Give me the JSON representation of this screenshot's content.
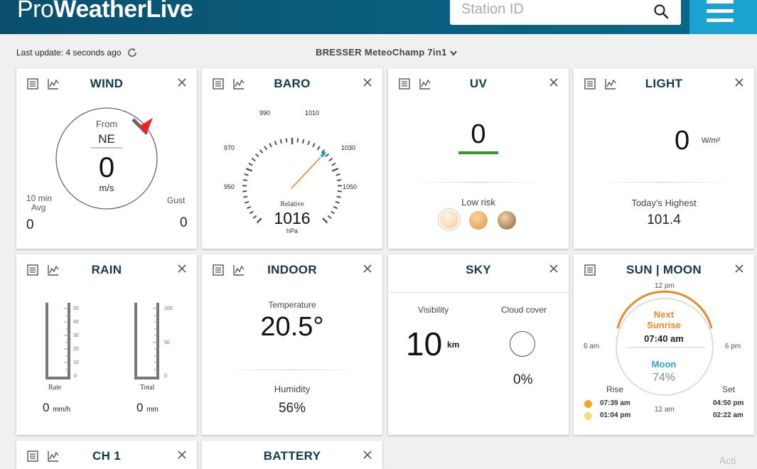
{
  "header": {
    "logo_pro": "Pro",
    "logo_weatherlive": "WeatherLive",
    "search_placeholder": "Station ID"
  },
  "subbar": {
    "last_update": "Last update: 4 seconds ago",
    "station": "BRESSER MeteoChamp 7in1"
  },
  "colors": {
    "header": "#0a5a7a",
    "menu": "#1aa3d1",
    "uv_bar": "#2e9b2e",
    "sun_arc": "#e8892b",
    "moon_text": "#2aa7c9"
  },
  "cards": {
    "wind": {
      "title": "WIND",
      "from_label": "From",
      "direction": "NE",
      "speed": "0",
      "unit": "m/s",
      "avg_label_1": "10 min",
      "avg_label_2": "Avg",
      "avg_value": "0",
      "gust_label": "Gust",
      "gust_value": "0"
    },
    "baro": {
      "title": "BARO",
      "ticks": [
        "950",
        "970",
        "990",
        "1010",
        "1030",
        "1050"
      ],
      "relative_label": "Relative",
      "value": "1016",
      "unit": "hPa"
    },
    "uv": {
      "title": "UV",
      "value": "0",
      "risk": "Low risk"
    },
    "light": {
      "title": "LIGHT",
      "value": "0",
      "unit": "W/m²",
      "highest_label": "Today's Highest",
      "highest_value": "101.4"
    },
    "rain": {
      "title": "RAIN",
      "rate_scale": [
        "50",
        "40",
        "30",
        "20",
        "10",
        "0"
      ],
      "total_scale": [
        "100",
        "50",
        "0"
      ],
      "rate_label": "Rate",
      "total_label": "Total",
      "rate_value": "0",
      "rate_unit": "mm/h",
      "total_value": "0",
      "total_unit": "mm"
    },
    "indoor": {
      "title": "INDOOR",
      "temp_label": "Temperature",
      "temp_value": "20.5°",
      "humidity_label": "Humidity",
      "humidity_value": "56%"
    },
    "sky": {
      "title": "SKY",
      "visibility_label": "Visibility",
      "visibility_value": "10",
      "visibility_unit": "km",
      "cloud_label": "Cloud cover",
      "cloud_value": "0%"
    },
    "sunmoon": {
      "title": "SUN | MOON",
      "label_12pm": "12 pm",
      "label_6am": "6 am",
      "label_6pm": "6 pm",
      "label_12am": "12 am",
      "next_label": "Next",
      "next_event": "Sunrise",
      "next_time": "07:40 am",
      "moon_label": "Moon",
      "moon_pct": "74%",
      "rise_label": "Rise",
      "set_label": "Set",
      "sun_rise": "07:39 am",
      "moon_rise": "01:04 pm",
      "sun_set": "04:50 pm",
      "moon_set": "02:22 am"
    },
    "ch1": {
      "title": "CH 1"
    },
    "battery": {
      "title": "BATTERY"
    }
  },
  "watermark": "Acti"
}
